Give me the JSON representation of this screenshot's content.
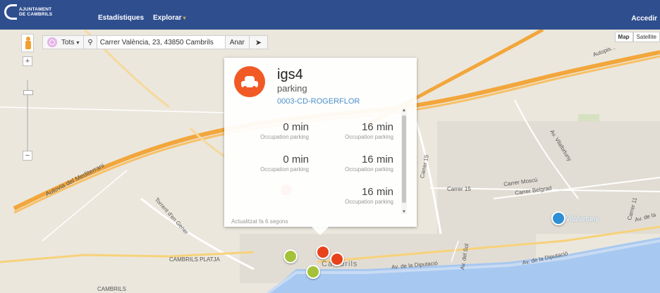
{
  "nav": {
    "logo_line1": "AJUNTAMENT",
    "logo_line2": "DE CAMBRILS",
    "items": [
      {
        "label": "Estadístiques"
      },
      {
        "label": "Explorar"
      }
    ],
    "login": "Accedir"
  },
  "toolbar": {
    "filter_label": "Tots",
    "address_value": "Carrer València, 23, 43850 Cambrils",
    "go_label": "Anar"
  },
  "map_controls": {
    "zoom_in": "+",
    "zoom_out": "−",
    "map_type": [
      "Map",
      "Satellite"
    ]
  },
  "popup": {
    "title": "igs4",
    "subtitle": "parking",
    "link": "0003-CD-ROGERFLOR",
    "metrics": [
      {
        "value": "0 min",
        "label": "Occupation parking"
      },
      {
        "value": "16 min",
        "label": "Occupation parking"
      },
      {
        "value": "0 min",
        "label": "Occupation parking"
      },
      {
        "value": "16 min",
        "label": "Occupation parking"
      },
      {
        "value": "16 min",
        "label": "Occupation parking"
      }
    ],
    "updated": "Actualitzat fa 6 segons"
  },
  "map_labels": {
    "autopista": "Autopis...",
    "autovia": "Autovia del Mediterrani",
    "torrent": "Torrent d'en Gener",
    "platja": "CAMBRILS PLATJA",
    "cambrils_low": "CAMBRILS",
    "cambrils": "Cambrils",
    "carrer15": "Carrer 15",
    "carrer15b": "Carrer 15",
    "moscu": "Carrer Moscú",
    "belgrad": "Carrer Belgrad",
    "vilafortuny_av": "Av. Vilafortuny",
    "vilafortuny": "Vilafortuny",
    "diputacio1": "Av. de la Diputació",
    "diputacio2": "Av. de la Diputació",
    "carrer11": "Carrer 11",
    "avsol": "Av. del Sol",
    "avdela": "Av. de la"
  },
  "colors": {
    "nav_bg": "#2f4e8e",
    "accent": "#f15a24",
    "link": "#4a90c8"
  }
}
